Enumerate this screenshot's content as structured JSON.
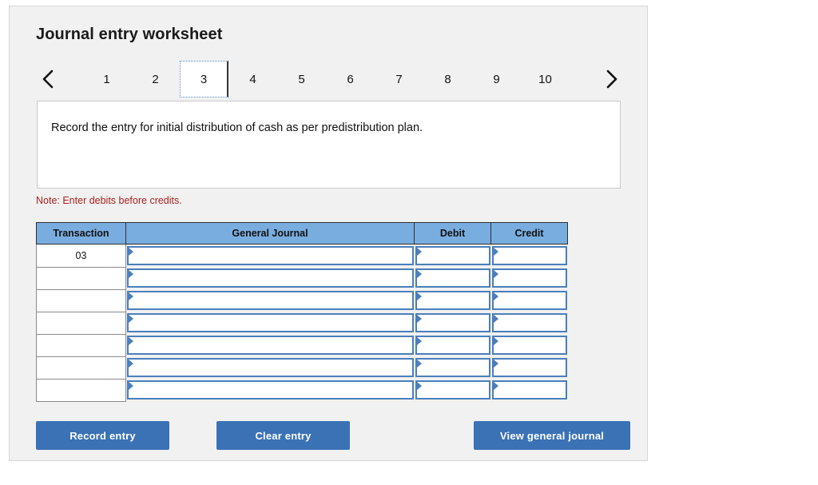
{
  "panel": {
    "title": "Journal entry worksheet",
    "background_color": "#f1f1f1",
    "border_color": "#d6d6d6"
  },
  "pager": {
    "prev_icon": "chevron-left-icon",
    "next_icon": "chevron-right-icon",
    "active_tab": "3",
    "tabs": [
      {
        "label": "1",
        "active": false
      },
      {
        "label": "2",
        "active": false
      },
      {
        "label": "3",
        "active": true
      },
      {
        "label": "4",
        "active": false
      },
      {
        "label": "5",
        "active": false
      },
      {
        "label": "6",
        "active": false
      },
      {
        "label": "7",
        "active": false
      },
      {
        "label": "8",
        "active": false
      },
      {
        "label": "9",
        "active": false
      },
      {
        "label": "10",
        "active": false
      }
    ]
  },
  "prompt": {
    "text": "Record the entry for initial distribution of cash as per predistribution plan."
  },
  "note": {
    "text": "Note: Enter debits before credits.",
    "color": "#aa1f1f"
  },
  "table": {
    "header_color": "#7aaddf",
    "cell_border_color": "#4a7fbd",
    "columns": [
      {
        "key": "transaction",
        "label": "Transaction"
      },
      {
        "key": "general_journal",
        "label": "General Journal"
      },
      {
        "key": "debit",
        "label": "Debit"
      },
      {
        "key": "credit",
        "label": "Credit"
      }
    ],
    "rows": [
      {
        "transaction": "03",
        "general_journal": "",
        "debit": "",
        "credit": ""
      },
      {
        "transaction": "",
        "general_journal": "",
        "debit": "",
        "credit": ""
      },
      {
        "transaction": "",
        "general_journal": "",
        "debit": "",
        "credit": ""
      },
      {
        "transaction": "",
        "general_journal": "",
        "debit": "",
        "credit": ""
      },
      {
        "transaction": "",
        "general_journal": "",
        "debit": "",
        "credit": ""
      },
      {
        "transaction": "",
        "general_journal": "",
        "debit": "",
        "credit": ""
      },
      {
        "transaction": "",
        "general_journal": "",
        "debit": "",
        "credit": ""
      }
    ]
  },
  "buttons": {
    "record_entry": "Record entry",
    "clear_entry": "Clear entry",
    "view_general_journal": "View general journal",
    "color": "#3a72b5"
  }
}
